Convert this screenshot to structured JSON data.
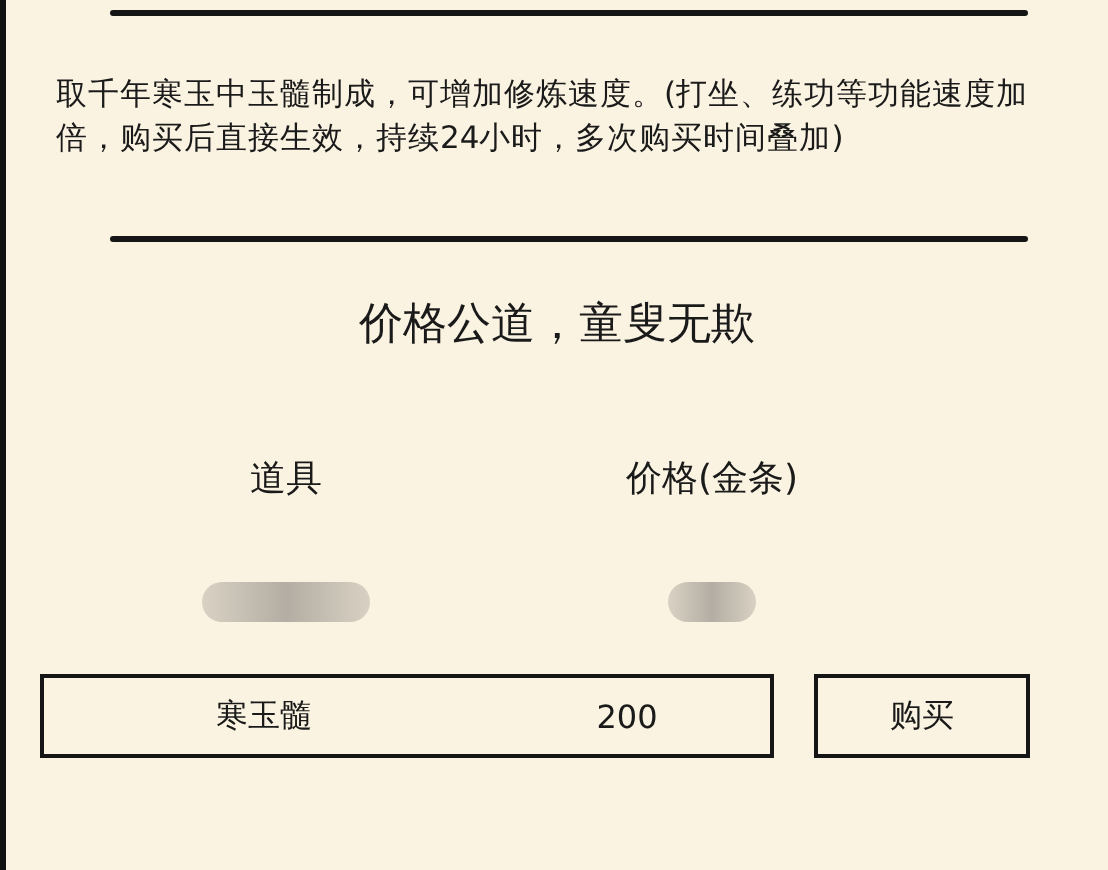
{
  "description": "取千年寒玉中玉髓制成，可增加修炼速度。(打坐、练功等功能速度加倍，购买后直接生效，持续24小时，多次购买时间叠加)",
  "heading": "价格公道，童叟无欺",
  "columns": [
    "道具",
    "价格(金条)"
  ],
  "item": {
    "name": "寒玉髓",
    "price": "200"
  },
  "buy_button": "购买"
}
